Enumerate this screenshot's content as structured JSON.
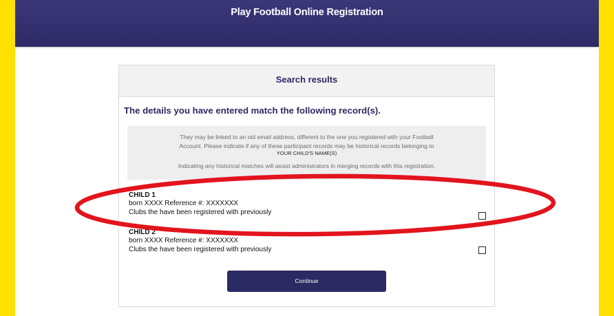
{
  "header": {
    "title": "Play Football Online Registration"
  },
  "card": {
    "title": "Search results",
    "match_heading": "The details you have entered match the following record(s).",
    "info": {
      "line1": "They may be linked to an old email address, different to the one you registered with your Football",
      "line2": "Account. Please indicate if any of these participant records may be historical records belonging to",
      "name_placeholder": "YOUR CHILD'S NAME(S)",
      "line3": "Indicating any historical matches will assist administrators in merging records with this registration."
    },
    "records": [
      {
        "name": "CHILD 1",
        "details": "born XXXX Reference #: XXXXXXX",
        "clubs": "Clubs the have been registered with previously",
        "checked": false
      },
      {
        "name": "CHILD 2",
        "details": "born XXXX Reference #: XXXXXXX",
        "clubs": "Clubs the have been registered with previously",
        "checked": false
      }
    ],
    "continue_label": "Continue"
  },
  "colors": {
    "background_yellow": "#ffe000",
    "brand_navy": "#2c2a62",
    "highlight_red": "#e2141d"
  }
}
